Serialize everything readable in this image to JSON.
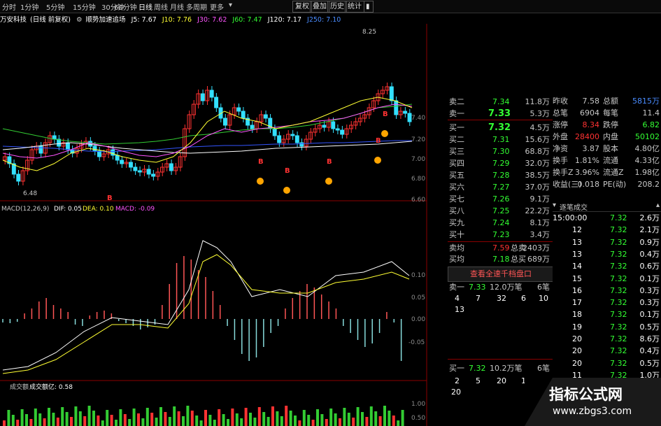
{
  "toolbar": {
    "periods": [
      "分时",
      "1分钟",
      "5分钟",
      "15分钟",
      "30分钟",
      "60分钟",
      "日线",
      "周线",
      "月线",
      "多周期",
      "更多"
    ],
    "selected": "日线",
    "buttons": [
      "复权",
      "叠加",
      "历史",
      "统计"
    ]
  },
  "info": {
    "stock": "万安科技",
    "mode": "(日线 前复权)",
    "indicator": "顺势加速追场",
    "j5": "J5: 7.67",
    "j10": "J10: 7.76",
    "j30": "J30: 7.62",
    "j60": "J60: 7.47",
    "j120": "J120: 7.17",
    "j250": "J250: 7.10"
  },
  "price_axis": {
    "top": "8.25",
    "labels": [
      "7.40",
      "7.20",
      "7.00",
      "6.80",
      "6.60"
    ],
    "low_mark": "6.48",
    "b_mark": "B"
  },
  "macd": {
    "title": "MACD(12,26,9)",
    "dif": "DIF: 0.05",
    "dea": "DEA: 0.10",
    "macd": "MACD: -0.09",
    "axis": [
      "0.10",
      "0.05",
      "0.00",
      "-0.05"
    ]
  },
  "volume": {
    "title": "成交额",
    "label": "成交额亿: 0.58",
    "axis": [
      "1.00",
      "0.50"
    ]
  },
  "orderbook": {
    "sell": [
      {
        "label": "卖二",
        "price": "7.34",
        "vol": "11.8万"
      },
      {
        "label": "卖一",
        "price": "7.33",
        "vol": "5.3万"
      }
    ],
    "last": {
      "price": "7.32",
      "vol": "4.5万",
      "label": "买一"
    },
    "buy": [
      {
        "label": "买二",
        "price": "7.31",
        "vol": "15.6万"
      },
      {
        "label": "买三",
        "price": "7.30",
        "vol": "68.8万"
      },
      {
        "label": "买四",
        "price": "7.29",
        "vol": "32.0万"
      },
      {
        "label": "买五",
        "price": "7.28",
        "vol": "38.5万"
      },
      {
        "label": "买六",
        "price": "7.27",
        "vol": "37.0万"
      },
      {
        "label": "买七",
        "price": "7.26",
        "vol": "9.1万"
      },
      {
        "label": "买八",
        "price": "7.25",
        "vol": "22.2万"
      },
      {
        "label": "买九",
        "price": "7.24",
        "vol": "8.1万"
      },
      {
        "label": "买十",
        "price": "7.23",
        "vol": "3.4万"
      }
    ],
    "avg_sell": {
      "label": "卖均",
      "price": "7.59",
      "k": "总卖",
      "v": "2403万"
    },
    "avg_buy": {
      "label": "买均",
      "price": "7.18",
      "k": "总买",
      "v": "689万"
    },
    "full_book_button": "查看全速千档盘口",
    "sell1_detail": {
      "label": "卖一",
      "price": "7.33",
      "vol": "12.0万笔",
      "cnt": "6笔",
      "q": [
        "4",
        "7",
        "32",
        "6",
        "10",
        "13"
      ]
    },
    "buy1_detail": {
      "label": "买一",
      "price": "7.32",
      "vol": "10.2万笔",
      "cnt": "6笔",
      "q": [
        "2",
        "5",
        "20",
        "10",
        "20"
      ]
    }
  },
  "stats": [
    {
      "k1": "昨收",
      "v1": "7.58",
      "k2": "总额",
      "v2": "5815万"
    },
    {
      "k1": "总笔",
      "v1": "6904",
      "k2": "每笔",
      "v2": "11.4"
    },
    {
      "k1": "涨停",
      "v1": "8.34",
      "k2": "跌停",
      "v2": "6.82"
    },
    {
      "k1": "外盘",
      "v1": "28400",
      "k2": "内盘",
      "v2": "50102"
    },
    {
      "k1": "净资",
      "v1": "3.87",
      "k2": "股本",
      "v2": "4.80亿"
    },
    {
      "k1": "换手",
      "v1": "1.81%",
      "k2": "流通",
      "v2": "4.33亿"
    },
    {
      "k1": "换手Z",
      "v1": "3.96%",
      "k2": "流通Z",
      "v2": "1.98亿"
    },
    {
      "k1": "收益(三)",
      "v1": "0.018",
      "k2": "PE(动)",
      "v2": "208.2"
    }
  ],
  "ticks": {
    "title": "逐笔成交",
    "rows": [
      {
        "t": "15:00:00",
        "p": "7.32",
        "v": "2.6万"
      },
      {
        "t": "12",
        "p": "7.32",
        "v": "2.1万"
      },
      {
        "t": "13",
        "p": "7.32",
        "v": "0.9万"
      },
      {
        "t": "13",
        "p": "7.32",
        "v": "0.4万"
      },
      {
        "t": "14",
        "p": "7.32",
        "v": "0.6万"
      },
      {
        "t": "15",
        "p": "7.32",
        "v": "0.1万"
      },
      {
        "t": "16",
        "p": "7.32",
        "v": "0.3万"
      },
      {
        "t": "17",
        "p": "7.32",
        "v": "0.3万"
      },
      {
        "t": "18",
        "p": "7.32",
        "v": "0.1万"
      },
      {
        "t": "19",
        "p": "7.32",
        "v": "0.5万"
      },
      {
        "t": "20",
        "p": "7.32",
        "v": "8.6万"
      },
      {
        "t": "20",
        "p": "7.32",
        "v": "0.4万"
      },
      {
        "t": "20",
        "p": "7.32",
        "v": "0.5万"
      },
      {
        "t": "11",
        "p": "7.32",
        "v": "1.0万"
      },
      {
        "t": "12",
        "p": "7.32",
        "v": "1.9万"
      },
      {
        "t": "",
        "p": "7.32",
        "v": "0.4万"
      },
      {
        "t": "",
        "p": "7.32",
        "v": "0.1万"
      }
    ]
  },
  "watermark": {
    "line1": "指标公式网",
    "line2": "www.zbgs3.com"
  },
  "colors": {
    "up": "#ff3232",
    "down": "#33ff33",
    "ma5": "#ffffff",
    "ma10": "#ffff33",
    "ma30": "#ff55ff",
    "ma60": "#33cc33",
    "ma120": "#ffffff",
    "ma250": "#3355ff"
  }
}
